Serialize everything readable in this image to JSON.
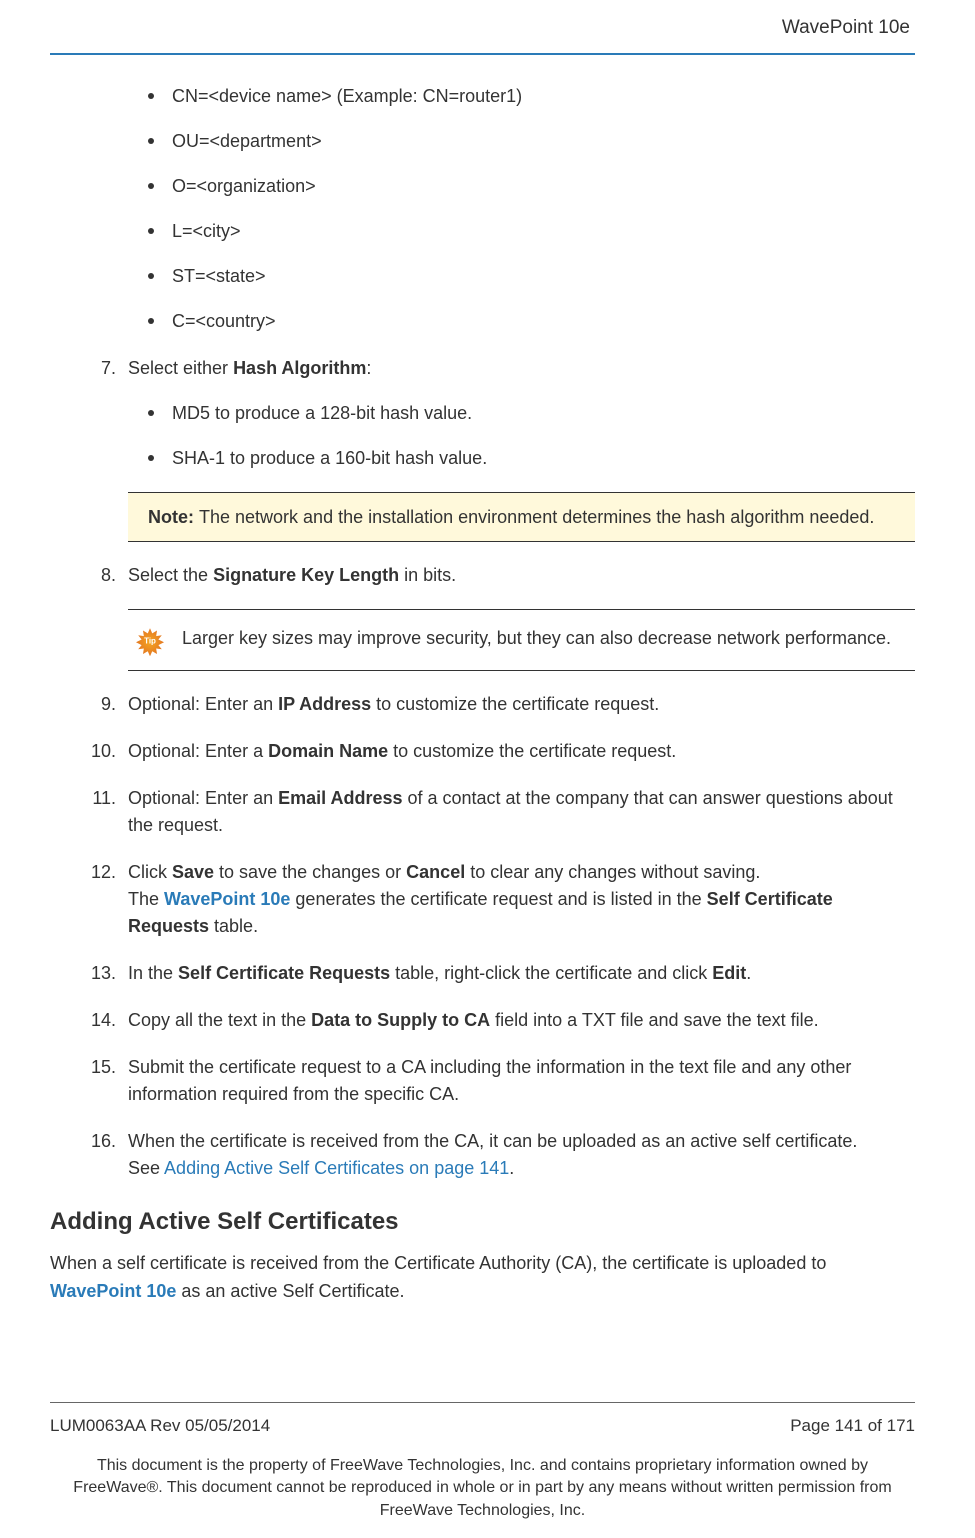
{
  "header": {
    "product": "WavePoint 10e"
  },
  "bullets": [
    "CN=<device name> (Example: CN=router1)",
    "OU=<department>",
    "O=<organization>",
    "L=<city>",
    "ST=<state>",
    "C=<country>"
  ],
  "step7": {
    "num": "7.",
    "pre": "Select either ",
    "bold": "Hash Algorithm",
    "post": ":",
    "sub": [
      "MD5 to produce a 128-bit hash value.",
      "SHA-1 to produce a 160-bit hash value."
    ]
  },
  "note": {
    "label": "Note: ",
    "text": "The network and the installation environment determines the hash algorithm needed."
  },
  "step8": {
    "num": "8.",
    "pre": "Select the ",
    "bold": "Signature Key Length",
    "post": " in bits."
  },
  "tip": {
    "badge": "Tip",
    "text": "Larger key sizes may improve security, but they can also decrease network performance."
  },
  "step9": {
    "num": "9.",
    "pre": "Optional: Enter an ",
    "bold": "IP Address",
    "post": " to customize the certificate request."
  },
  "step10": {
    "num": "10.",
    "pre": "Optional: Enter a ",
    "bold": "Domain Name",
    "post": " to customize the certificate request."
  },
  "step11": {
    "num": "11.",
    "pre": "Optional: Enter an ",
    "bold": "Email Address",
    "post": " of a contact at the company that can answer questions about the request."
  },
  "step12": {
    "num": "12.",
    "l1a": "Click ",
    "l1b": "Save",
    "l1c": " to save the changes or ",
    "l1d": "Cancel",
    "l1e": " to clear any changes without saving.",
    "l2a": "The ",
    "l2link": "WavePoint 10e",
    "l2b": " generates the certificate request and is listed in the ",
    "l2c": "Self Certificate Requests",
    "l2d": " table."
  },
  "step13": {
    "num": "13.",
    "a": "In the ",
    "b": "Self Certificate Requests",
    "c": " table, right-click the certificate and click ",
    "d": "Edit",
    "e": "."
  },
  "step14": {
    "num": "14.",
    "a": "Copy all the text in the ",
    "b": "Data to Supply to CA",
    "c": " field into a TXT file and save the text file."
  },
  "step15": {
    "num": "15.",
    "text": "Submit the certificate request to a CA including the information in the text file and any other information required from the specific CA."
  },
  "step16": {
    "num": "16.",
    "l1": "When the certificate is received from the CA, it can be uploaded as an active self certificate.",
    "l2a": "See ",
    "l2link": "Adding Active Self Certificates on page 141",
    "l2b": "."
  },
  "section": {
    "heading": "Adding Active Self Certificates",
    "p1a": "When a self certificate is received from the Certificate Authority (CA), the certificate is uploaded to ",
    "p1link": "WavePoint 10e",
    "p1b": " as an active Self Certificate."
  },
  "footer": {
    "left": "LUM0063AA Rev 05/05/2014",
    "right": "Page 141 of 171",
    "legal": "This document is the property of FreeWave Technologies, Inc. and contains proprietary information owned by FreeWave®. This document cannot be reproduced in whole or in part by any means without written permission from FreeWave Technologies, Inc."
  }
}
